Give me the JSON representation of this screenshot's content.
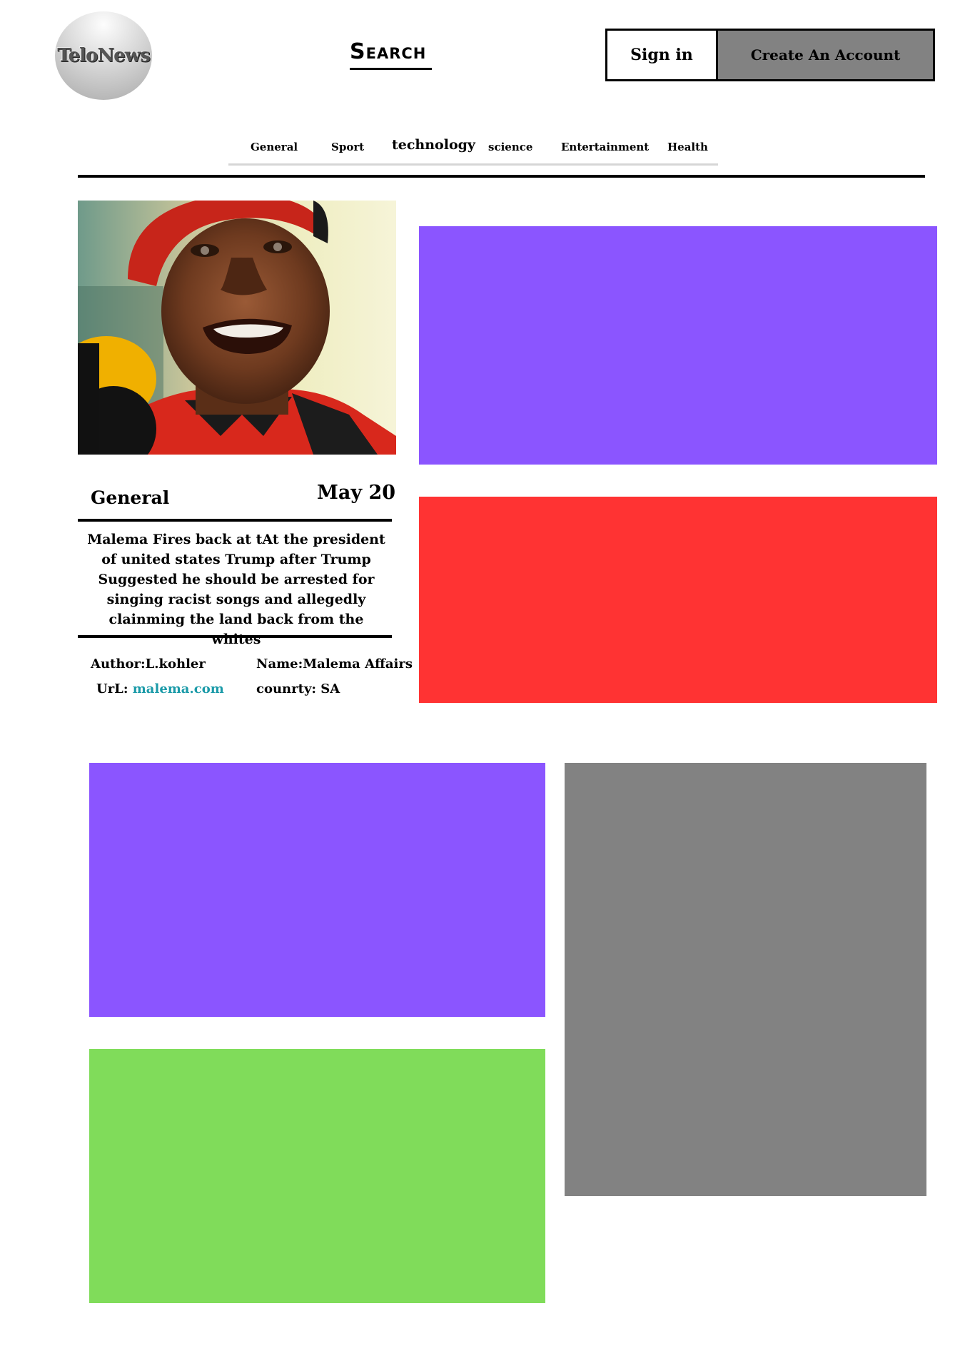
{
  "header": {
    "logo_text": "TeloNews",
    "search_label": "Search",
    "signin_label": "Sign in",
    "create_account_label": "Create An Account"
  },
  "nav": {
    "items": [
      {
        "label": "General"
      },
      {
        "label": "Sport"
      },
      {
        "label": "technology"
      },
      {
        "label": "science"
      },
      {
        "label": "Entertainment"
      },
      {
        "label": "Health"
      }
    ]
  },
  "article": {
    "category": "General",
    "date": "May 20",
    "headline": "Malema Fires back at tAt the president of united states Trump after Trump Suggested he should be arrested for singing racist songs and allegedly clainming the land back from the whites",
    "author": "Author:L.kohler",
    "url_label": "UrL:",
    "url_link": "malema.com",
    "name": "Name:Malema Affairs",
    "country": "counrty: SA"
  },
  "colors": {
    "purple": "#8b55ff",
    "red": "#ff3333",
    "green": "#80dc5a",
    "gray": "#828282",
    "link": "#1a9aa8"
  }
}
